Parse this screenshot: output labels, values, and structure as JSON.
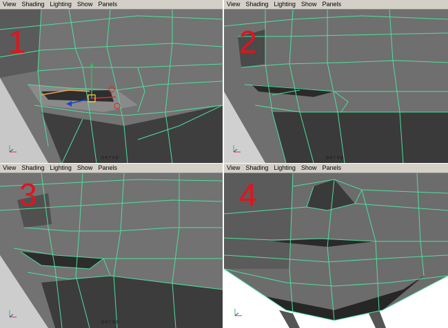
{
  "panels": [
    {
      "number": "1",
      "menu": [
        "View",
        "Shading",
        "Lighting",
        "Show",
        "Panels"
      ],
      "camera": "persp"
    },
    {
      "number": "2",
      "menu": [
        "View",
        "Shading",
        "Lighting",
        "Show",
        "Panels"
      ],
      "camera": "persp"
    },
    {
      "number": "3",
      "menu": [
        "View",
        "Shading",
        "Lighting",
        "Show",
        "Panels"
      ],
      "camera": "persp"
    },
    {
      "number": "4",
      "menu": [
        "View",
        "Shading",
        "Lighting",
        "Show",
        "Panels"
      ],
      "camera": "persp"
    }
  ],
  "axis_labels": {
    "x": "x",
    "y": "y",
    "z": "z"
  },
  "colors": {
    "wire": "#4fe0a0",
    "mesh": "#6e6e6e",
    "mesh_dark": "#3a3a3a",
    "active_border": "#1f3a9e",
    "number": "#e0141e",
    "menubar": "#d4d0c8"
  },
  "icons": {
    "manipulator": "move-manipulator-icon",
    "axis": "axis-triad-icon"
  }
}
